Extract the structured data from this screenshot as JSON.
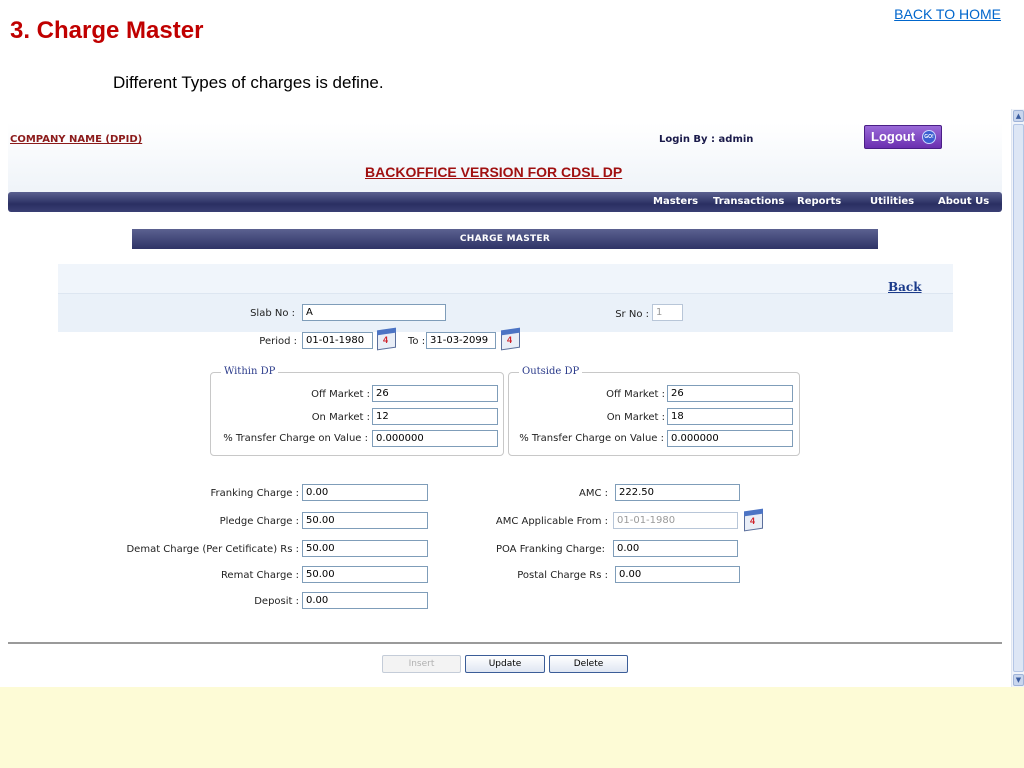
{
  "slide": {
    "title": "3. Charge Master",
    "back_to_home": "BACK TO HOME",
    "subtitle": "Different Types of charges is define."
  },
  "app": {
    "company": "COMPANY NAME (DPID)",
    "login_by": "Login By : admin",
    "logout": "Logout",
    "go_badge": "GO!",
    "title": "BACKOFFICE VERSION FOR CDSL DP"
  },
  "nav": {
    "items": [
      {
        "label": "Masters"
      },
      {
        "label": "Transactions"
      },
      {
        "label": "Reports"
      },
      {
        "label": "Utilities"
      },
      {
        "label": "About Us"
      }
    ]
  },
  "page": {
    "section_title": "CHARGE MASTER",
    "back": "Back"
  },
  "form": {
    "slab_no_label": "Slab No :",
    "slab_no_value": "A",
    "sr_no_label": "Sr No :",
    "sr_no_value": "1",
    "period_label": "Period :",
    "period_from": "01-01-1980",
    "to_label": "To :",
    "period_to": "31-03-2099",
    "within_dp": {
      "legend": "Within DP",
      "off_market_label": "Off Market :",
      "off_market_value": "26",
      "on_market_label": "On Market :",
      "on_market_value": "12",
      "transfer_label": "% Transfer Charge on Value :",
      "transfer_value": "0.000000"
    },
    "outside_dp": {
      "legend": "Outside DP",
      "off_market_label": "Off Market :",
      "off_market_value": "26",
      "on_market_label": "On Market :",
      "on_market_value": "18",
      "transfer_label": "% Transfer Charge on Value :",
      "transfer_value": "0.000000"
    },
    "franking_label": "Franking Charge :",
    "franking_value": "0.00",
    "pledge_label": "Pledge Charge :",
    "pledge_value": "50.00",
    "demat_label": "Demat Charge (Per Cetificate) Rs :",
    "demat_value": "50.00",
    "remat_label": "Remat Charge :",
    "remat_value": "50.00",
    "deposit_label": "Deposit :",
    "deposit_value": "0.00",
    "amc_label": "AMC :",
    "amc_value": "222.50",
    "amc_from_label": "AMC Applicable From :",
    "amc_from_value": "01-01-1980",
    "poa_label": "POA Franking Charge:",
    "poa_value": "0.00",
    "postal_label": "Postal Charge Rs :",
    "postal_value": "0.00"
  },
  "buttons": {
    "insert": "Insert",
    "update": "Update",
    "delete": "Delete"
  },
  "calendar_icon_number": "4",
  "colors": {
    "slide_title": "#c00000",
    "nav_bar": "#2a2f62",
    "slide_footer": "#fdfbd6"
  }
}
